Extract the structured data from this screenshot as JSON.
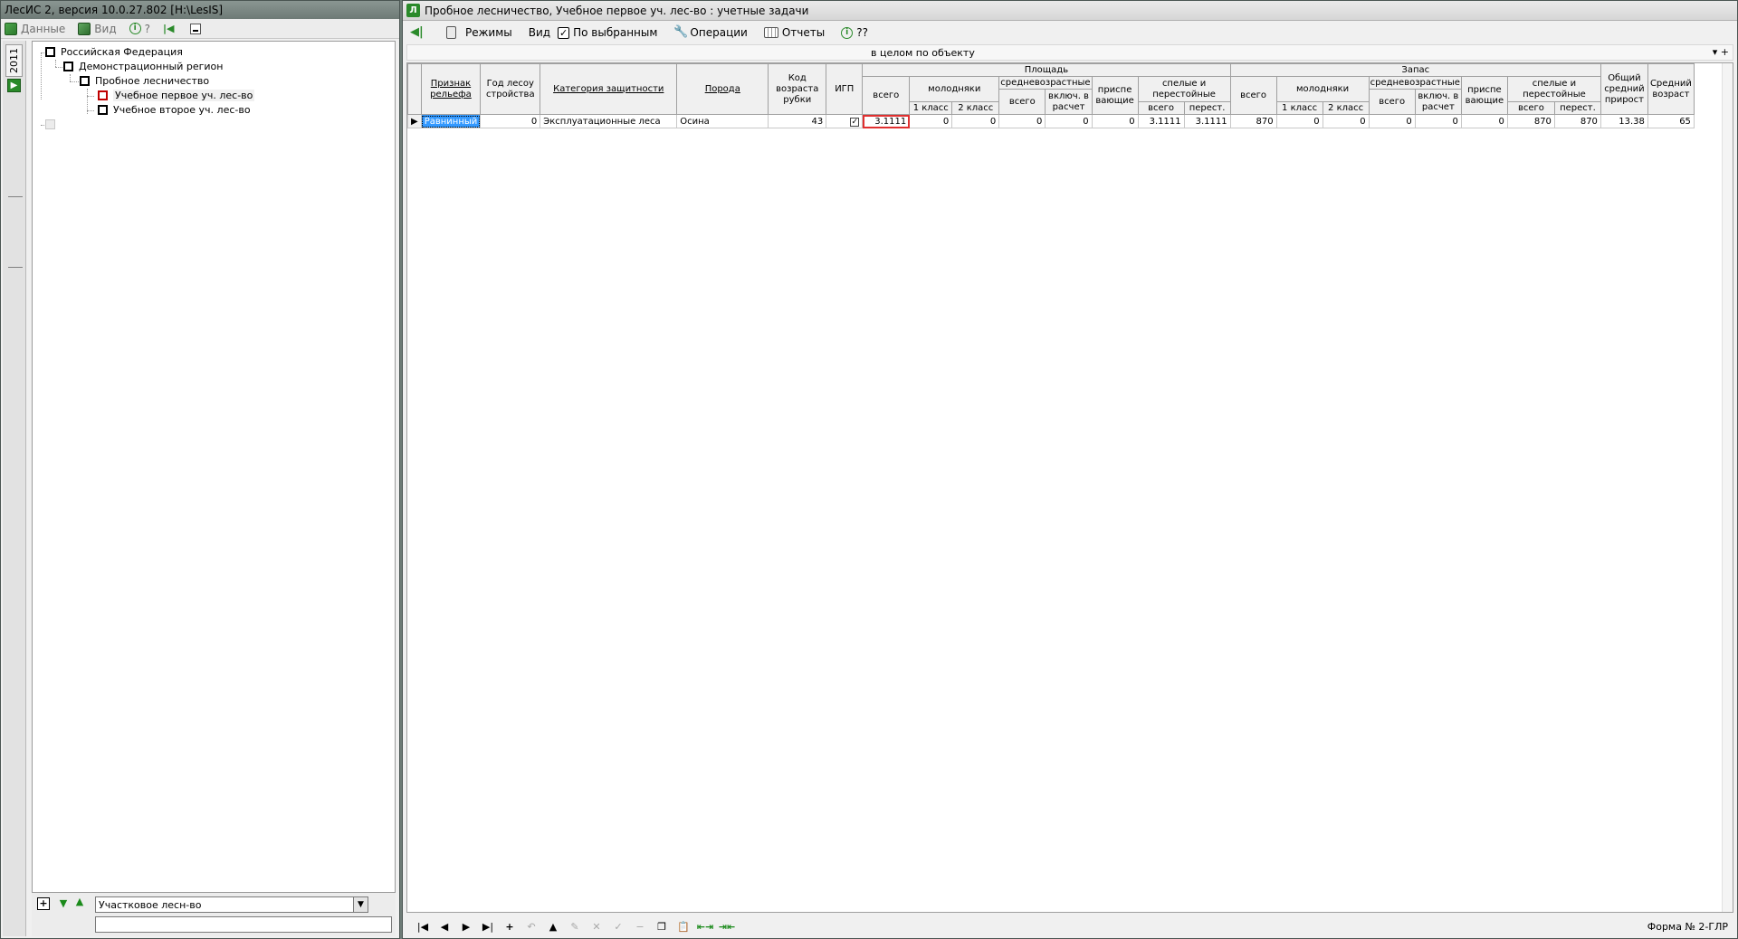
{
  "left_window": {
    "title": "ЛесИС 2, версия 10.0.27.802",
    "path": "[H:\\LesIS]",
    "menu": [
      {
        "label": "Данные",
        "icon": "database-icon"
      },
      {
        "label": "Вид",
        "icon": "view-icon"
      },
      {
        "label": "?",
        "icon": "info-icon"
      }
    ],
    "year_tab": "2011",
    "tree": [
      {
        "label": "Российская Федерация",
        "level": 0
      },
      {
        "label": "Демонстрационный  регион",
        "level": 1
      },
      {
        "label": "Пробное лесничество",
        "level": 2
      },
      {
        "label": "Учебное первое уч. лес-во",
        "level": 3,
        "selected": true
      },
      {
        "label": "Учебное второе уч. лес-во",
        "level": 3
      }
    ],
    "level_combo": "Участковое лесн-во",
    "filter_value": ""
  },
  "right_window": {
    "title": "Пробное лесничество, Учебное первое уч. лес-во : учетные задачи",
    "menu": {
      "modes": "Режимы",
      "view": "Вид",
      "by_selected": "По выбранным",
      "operations": "Операции",
      "reports": "Отчеты",
      "help": "??"
    },
    "scope": "в целом по объекту",
    "scope_controls": "▾ +",
    "headers": {
      "relief": "Признак рельефа",
      "year": "Год лесоу стройства",
      "category": "Категория защитности",
      "species": "Порода",
      "age_code": "Код возраста рубки",
      "igp": "ИГП",
      "area": "Площадь",
      "stock": "Запас",
      "total": "всего",
      "young": "молодняки",
      "class1": "1 класс",
      "class2": "2 класс",
      "middle": "средневозрастные",
      "incl": "включ. в расчет",
      "ripening": "приспе вающие",
      "mature": "спелые и перестойные",
      "overmature": "перест.",
      "growth": "Общий средний прирост",
      "avg_age": "Средний возраст"
    },
    "rows": [
      {
        "relief": "Равнинный",
        "year": "0",
        "category": "Эксплуатационные леса",
        "species": "Осина",
        "age_code": "43",
        "igp": "✓",
        "area": [
          "3.1111",
          "0",
          "0",
          "0",
          "0",
          "0",
          "3.1111",
          "3.1111"
        ],
        "stock": [
          "870",
          "0",
          "0",
          "0",
          "0",
          "0",
          "870",
          "870"
        ],
        "growth": "13.38",
        "avg_age": "65"
      }
    ],
    "form_label": "Форма № 2-ГЛР"
  }
}
